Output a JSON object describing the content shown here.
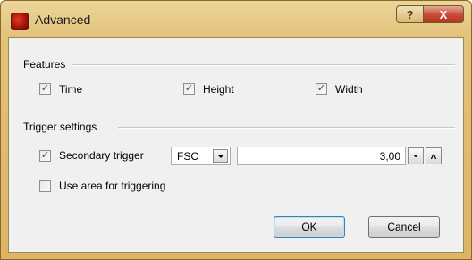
{
  "window": {
    "title": "Advanced"
  },
  "titlebar": {
    "help_glyph": "?",
    "close_glyph": "X"
  },
  "features": {
    "group_label": "Features",
    "time": {
      "label": "Time",
      "checked": true
    },
    "height": {
      "label": "Height",
      "checked": true
    },
    "width": {
      "label": "Width",
      "checked": true
    }
  },
  "trigger": {
    "group_label": "Trigger settings",
    "secondary": {
      "label": "Secondary trigger",
      "checked": true
    },
    "channel": {
      "selected": "FSC"
    },
    "threshold": {
      "value": "3,00"
    },
    "use_area": {
      "label": "Use area for triggering",
      "checked": false
    }
  },
  "buttons": {
    "ok": "OK",
    "cancel": "Cancel"
  },
  "icons": {
    "check": "✓",
    "spin_down": "⌄",
    "spin_up": "^"
  },
  "colors": {
    "frame": "#e3c27a",
    "close": "#c84a34",
    "client_bg": "#f0f0f0"
  }
}
